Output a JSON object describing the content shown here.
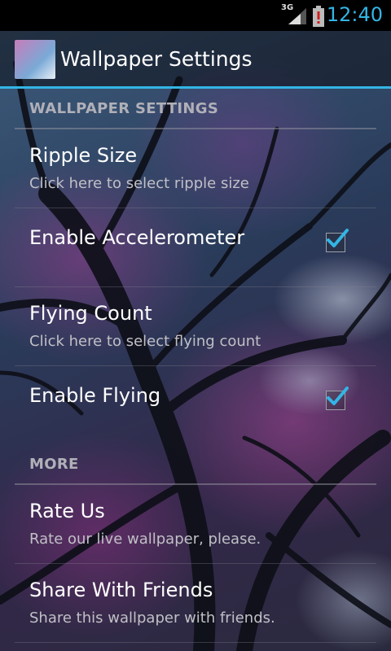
{
  "status_bar": {
    "network": "3G",
    "time": "12:40",
    "icons": [
      "signal-icon",
      "battery-alert-icon"
    ]
  },
  "action_bar": {
    "title": "Wallpaper Settings",
    "icon": "wallpaper-thumbnail-icon"
  },
  "sections": [
    {
      "header": "WALLPAPER SETTINGS",
      "items": [
        {
          "title": "Ripple Size",
          "summary": "Click here to select ripple size"
        },
        {
          "title": "Enable Accelerometer",
          "checked": true
        },
        {
          "title": "Flying Count",
          "summary": "Click here to select flying count"
        },
        {
          "title": "Enable Flying",
          "checked": true
        }
      ]
    },
    {
      "header": "MORE",
      "items": [
        {
          "title": "Rate Us",
          "summary": "Rate our live wallpaper, please."
        },
        {
          "title": "Share With Friends",
          "summary": "Share this wallpaper with friends."
        }
      ]
    }
  ],
  "colors": {
    "accent": "#33b5e5",
    "check": "#33b5e5"
  }
}
